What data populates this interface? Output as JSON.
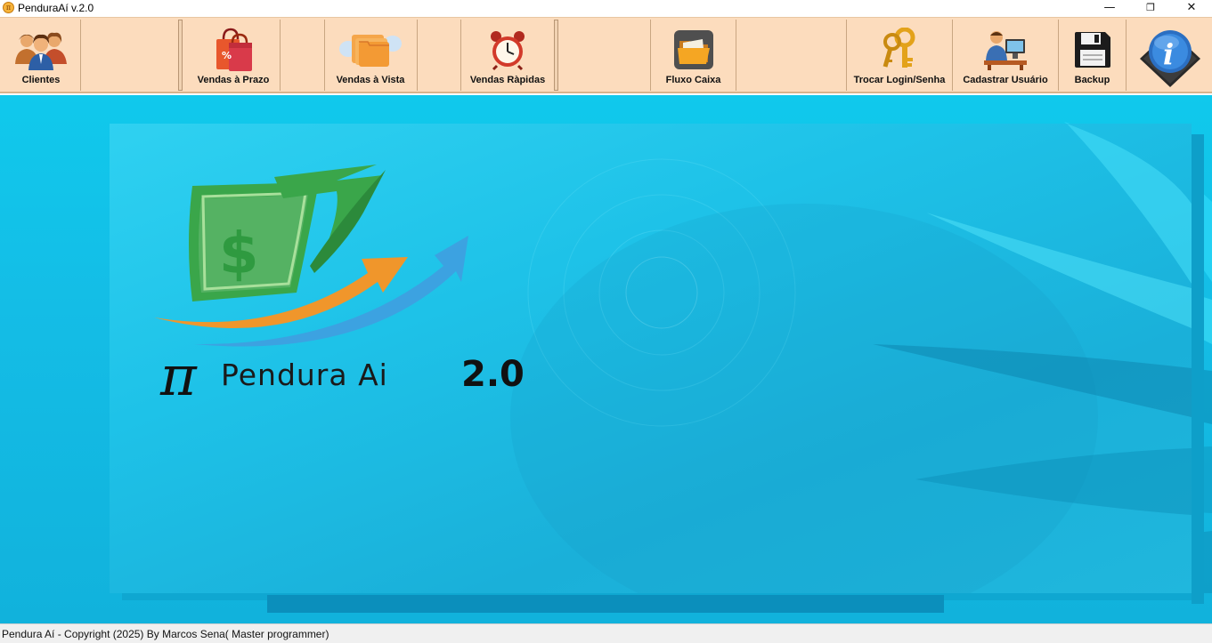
{
  "window": {
    "title": "PenduraAí v.2.0",
    "controls": {
      "minimize": "—",
      "restore": "❐",
      "close": "✕"
    }
  },
  "toolbar": {
    "clientes": "Clientes",
    "vendas_prazo": "Vendas à Prazo",
    "vendas_vista": "Vendas à Vista",
    "vendas_rapidas": "Vendas Ràpidas",
    "fluxo_caixa": "Fluxo Caixa",
    "trocar_login": "Trocar Login/Senha",
    "cadastrar_usuario": "Cadastrar Usuário",
    "backup": "Backup"
  },
  "icons": {
    "clientes": "users-icon",
    "vendas_prazo": "shopping-bag-icon",
    "vendas_vista": "folders-hand-icon",
    "vendas_rapidas": "alarm-clock-icon",
    "fluxo_caixa": "folder-icon",
    "trocar_login": "keys-icon",
    "cadastrar_usuario": "user-computer-icon",
    "backup": "floppy-disk-icon",
    "info": "info-icon"
  },
  "splash": {
    "pi": "π",
    "name": "Pendura Ai",
    "version": "2.0",
    "dollar": "$"
  },
  "status": {
    "text": "Pendura Aí - Copyright (2025)  By Marcos Sena( Master programmer)"
  },
  "colors": {
    "toolbar_bg": "#fcdcbd",
    "main_bg": "#14bde6",
    "logo_green": "#3aa64a",
    "logo_orange": "#f0962b",
    "logo_blue": "#3f9fe0"
  }
}
